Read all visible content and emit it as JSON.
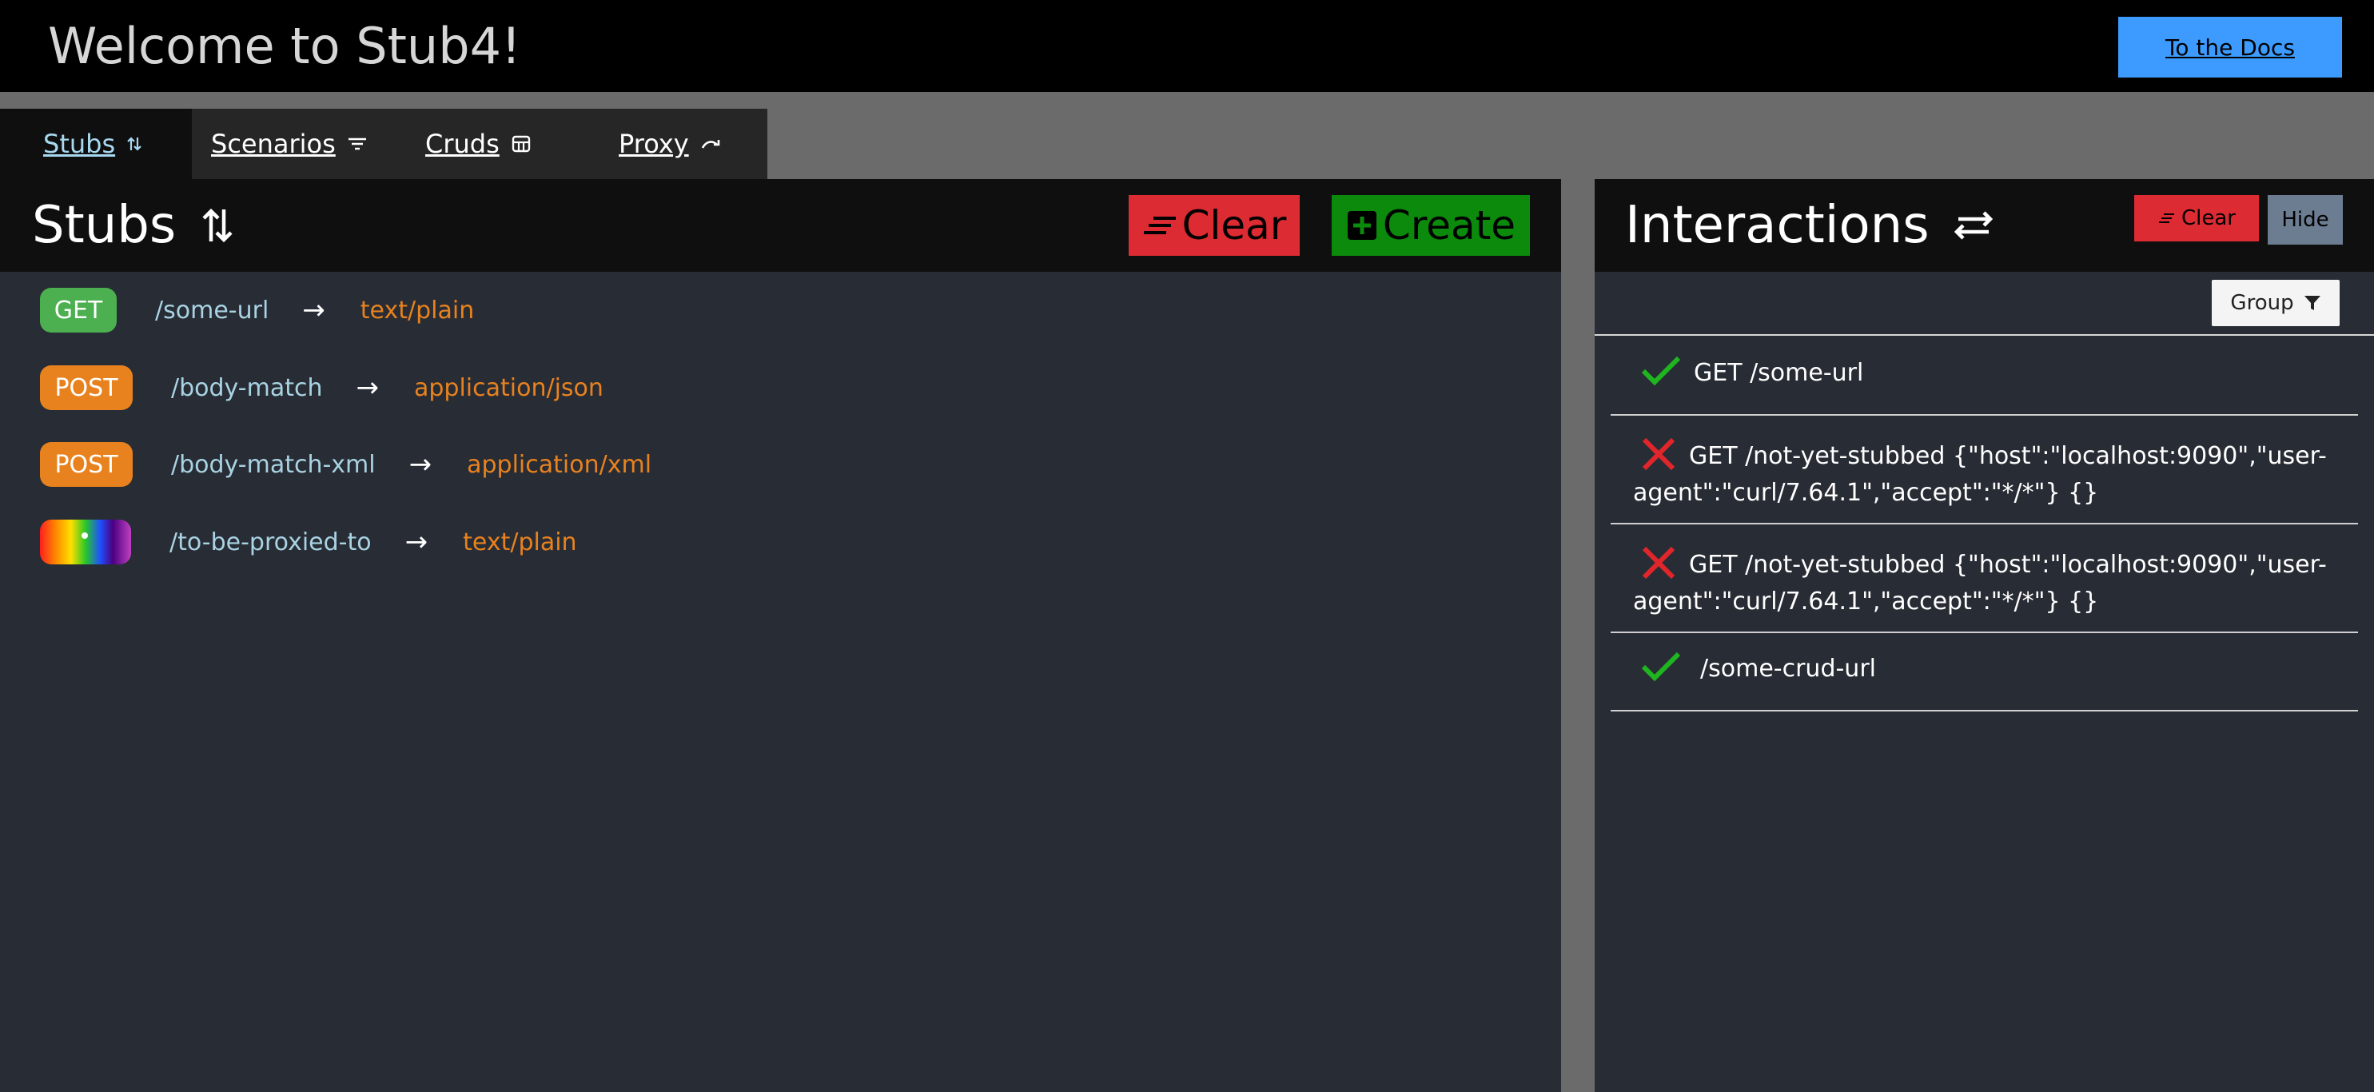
{
  "header": {
    "title": "Welcome to Stub4!",
    "docs_button": "To the Docs"
  },
  "tabs": [
    {
      "label": "Stubs",
      "icon": "sort-arrows-icon",
      "active": true
    },
    {
      "label": "Scenarios",
      "icon": "filter-lines-icon"
    },
    {
      "label": "Cruds",
      "icon": "database-table-icon"
    },
    {
      "label": "Proxy",
      "icon": "redo-arrow-icon"
    }
  ],
  "stubs": {
    "title": "Stubs",
    "clear_label": "Clear",
    "create_label": "Create",
    "items": [
      {
        "method": "GET",
        "url": "/some-url",
        "arrow": "→",
        "type": "text/plain"
      },
      {
        "method": "POST",
        "url": "/body-match",
        "arrow": "→",
        "type": "application/json"
      },
      {
        "method": "POST",
        "url": "/body-match-xml",
        "arrow": "→",
        "type": "application/xml"
      },
      {
        "method": "",
        "url": "/to-be-proxied-to",
        "arrow": "→",
        "type": "text/plain"
      }
    ]
  },
  "interactions": {
    "title": "Interactions",
    "clear_label": "Clear",
    "hide_label": "Hide",
    "group_label": "Group",
    "items": [
      {
        "status": "matched",
        "text": "GET /some-url"
      },
      {
        "status": "unmatched",
        "text": "GET /not-yet-stubbed {\"host\":\"localhost:9090\",\"user-agent\":\"curl/7.64.1\",\"accept\":\"*/*\"} {}"
      },
      {
        "status": "unmatched",
        "text": "GET /not-yet-stubbed {\"host\":\"localhost:9090\",\"user-agent\":\"curl/7.64.1\",\"accept\":\"*/*\"} {}"
      },
      {
        "status": "matched",
        "text": "/some-crud-url"
      }
    ]
  },
  "colors": {
    "get": "#4caf50",
    "post": "#e8821e",
    "clear": "#dc2b32",
    "create": "#0b8a0b",
    "docs": "#3d9bff",
    "hide": "#6c7d91",
    "check": "#1fb51f",
    "cross": "#e0262b"
  }
}
